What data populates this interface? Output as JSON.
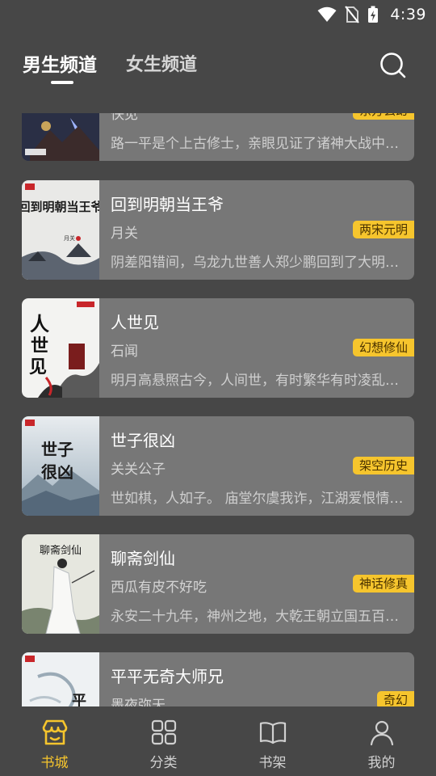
{
  "status_bar": {
    "time": "4:39"
  },
  "header": {
    "tabs": [
      {
        "label": "男生频道",
        "active": true
      },
      {
        "label": "女生频道",
        "active": false
      }
    ]
  },
  "books": [
    {
      "title": "",
      "author": "佚见",
      "tag": "东方玄幻",
      "description": "路一平是个上古修士，亲眼见证了诸神大战中…",
      "cover_text": "",
      "cover_publisher": "起点中文网"
    },
    {
      "title": "回到明朝当王爷",
      "author": "月关",
      "tag": "两宋元明",
      "description": "阴差阳错间，乌龙九世善人郑少鹏回到了大明…",
      "cover_text": "回到明朝当王爷",
      "cover_author": "月关",
      "cover_publisher": "起点中文网"
    },
    {
      "title": "人世见",
      "author": "石闻",
      "tag": "幻想修仙",
      "description": "明月高悬照古今，人间世，有时繁华有时凌乱…",
      "cover_text": "人世见",
      "cover_publisher": "起点中文网"
    },
    {
      "title": "世子很凶",
      "author": "关关公子",
      "tag": "架空历史",
      "description": "世如棋，人如子。 庙堂尔虞我诈，江湖爱恨情…",
      "cover_text": "世子很凶",
      "cover_publisher": "起点中文网"
    },
    {
      "title": "聊斋剑仙",
      "author": "西瓜有皮不好吃",
      "tag": "神话修真",
      "description": "永安二十九年，神州之地，大乾王朝立国五百…",
      "cover_text": "聊斋剑仙",
      "cover_publisher": "起点中文网"
    },
    {
      "title": "平平无奇大师兄",
      "author": "墨夜弥天",
      "tag": "奇幻",
      "description": "",
      "cover_text": "平",
      "cover_publisher": "起点中文网"
    }
  ],
  "bottom_nav": [
    {
      "label": "书城",
      "icon": "store-icon",
      "active": true
    },
    {
      "label": "分类",
      "icon": "grid-icon",
      "active": false
    },
    {
      "label": "书架",
      "icon": "book-icon",
      "active": false
    },
    {
      "label": "我的",
      "icon": "user-icon",
      "active": false
    }
  ],
  "colors": {
    "background": "#474747",
    "card": "#777777",
    "accent": "#f6c52d"
  }
}
